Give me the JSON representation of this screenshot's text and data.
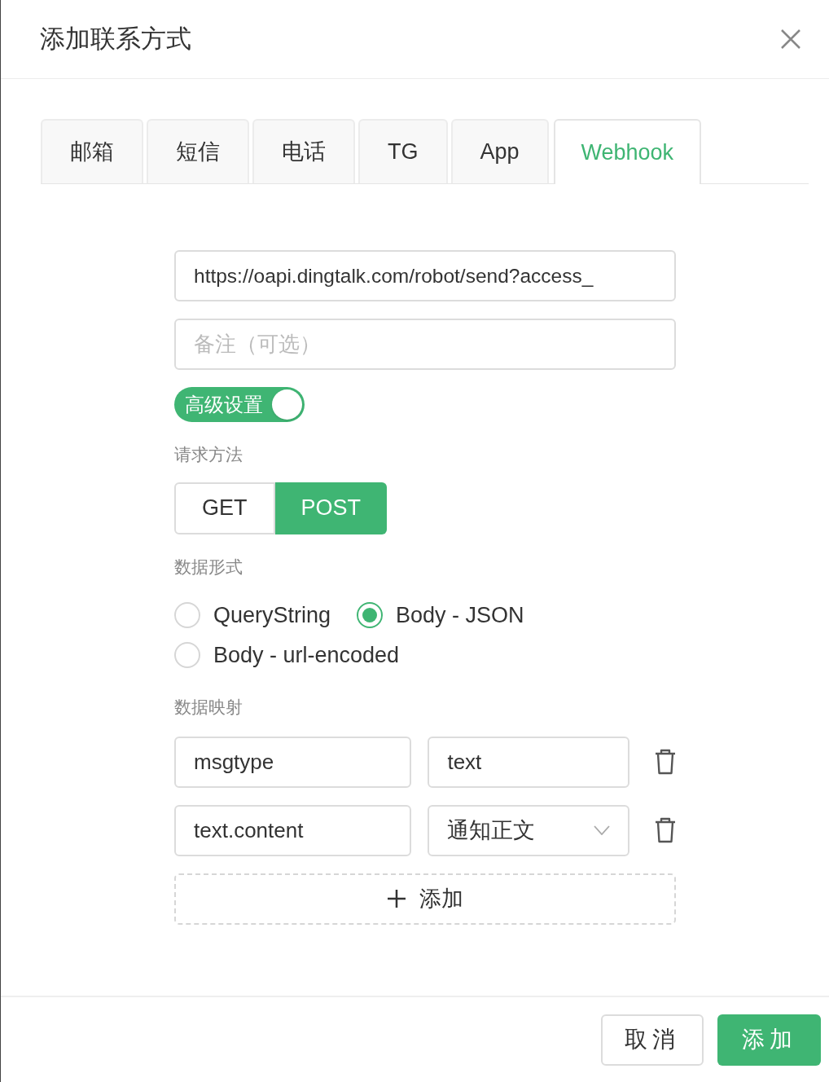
{
  "dialog": {
    "title": "添加联系方式",
    "tabs": [
      {
        "label": "邮箱",
        "selected": false
      },
      {
        "label": "短信",
        "selected": false
      },
      {
        "label": "电话",
        "selected": false
      },
      {
        "label": "TG",
        "selected": false
      },
      {
        "label": "App",
        "selected": false
      },
      {
        "label": "Webhook",
        "selected": true
      }
    ],
    "url_field": {
      "value": "https://oapi.dingtalk.com/robot/send?access_"
    },
    "note_field": {
      "placeholder": "备注（可选）"
    },
    "advanced_toggle": {
      "label": "高级设置",
      "on": true
    },
    "method": {
      "label": "请求方法",
      "options": [
        {
          "label": "GET",
          "selected": false
        },
        {
          "label": "POST",
          "selected": true
        }
      ]
    },
    "data_format": {
      "label": "数据形式",
      "options": [
        {
          "label": "QueryString",
          "selected": false
        },
        {
          "label": "Body - JSON",
          "selected": true
        },
        {
          "label": "Body - url-encoded",
          "selected": false
        }
      ]
    },
    "mapping": {
      "label": "数据映射",
      "rows": [
        {
          "key": "msgtype",
          "value": "text",
          "kind": "input"
        },
        {
          "key": "text.content",
          "value": "通知正文",
          "kind": "select"
        }
      ],
      "add_button": "添加"
    },
    "buttons": {
      "cancel": "取消",
      "confirm": "添加"
    }
  }
}
